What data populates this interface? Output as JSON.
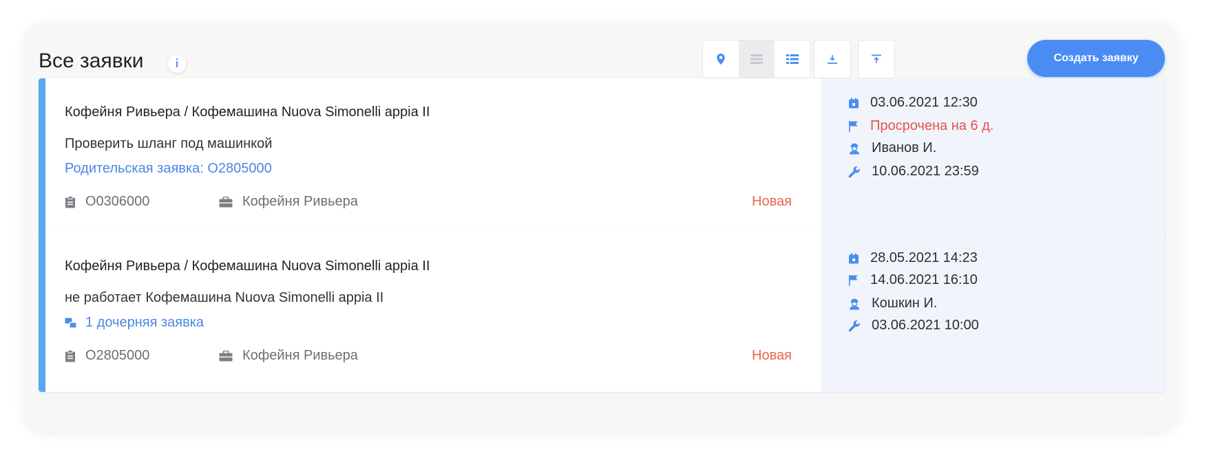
{
  "header": {
    "title": "Все заявки",
    "create_button": "Создать заявку"
  },
  "colors": {
    "accent": "#4b8cf3",
    "card_stripe": "#5aa8ee",
    "status_new": "#e8664a",
    "overdue": "#e55151",
    "link": "#4b86e6"
  },
  "toolbar_icons": [
    "map-pin-icon",
    "list-compact-icon",
    "list-detailed-icon",
    "download-icon",
    "upload-icon"
  ],
  "cards": [
    {
      "title": "Кофейня Ривьера / Кофемашина Nuova Simonelli appia II",
      "description": "Проверить шланг под машинкой",
      "link": "Родительская заявка: О2805000",
      "number": "О0306000",
      "client": "Кофейня Ривьера",
      "status": "Новая",
      "created": "03.06.2021 12:30",
      "deadline": "Просрочена на 6 д.",
      "assignee": "Иванов И.",
      "work_date": "10.06.2021 23:59"
    },
    {
      "title": "Кофейня Ривьера / Кофемашина Nuova Simonelli appia II",
      "description": "не работает Кофемашина Nuova Simonelli appia II",
      "link": "1 дочерняя заявка",
      "number": "О2805000",
      "client": "Кофейня Ривьера",
      "status": "Новая",
      "created": "28.05.2021 14:23",
      "deadline": "14.06.2021 16:10",
      "assignee": "Кошкин И.",
      "work_date": "03.06.2021 10:00"
    }
  ]
}
